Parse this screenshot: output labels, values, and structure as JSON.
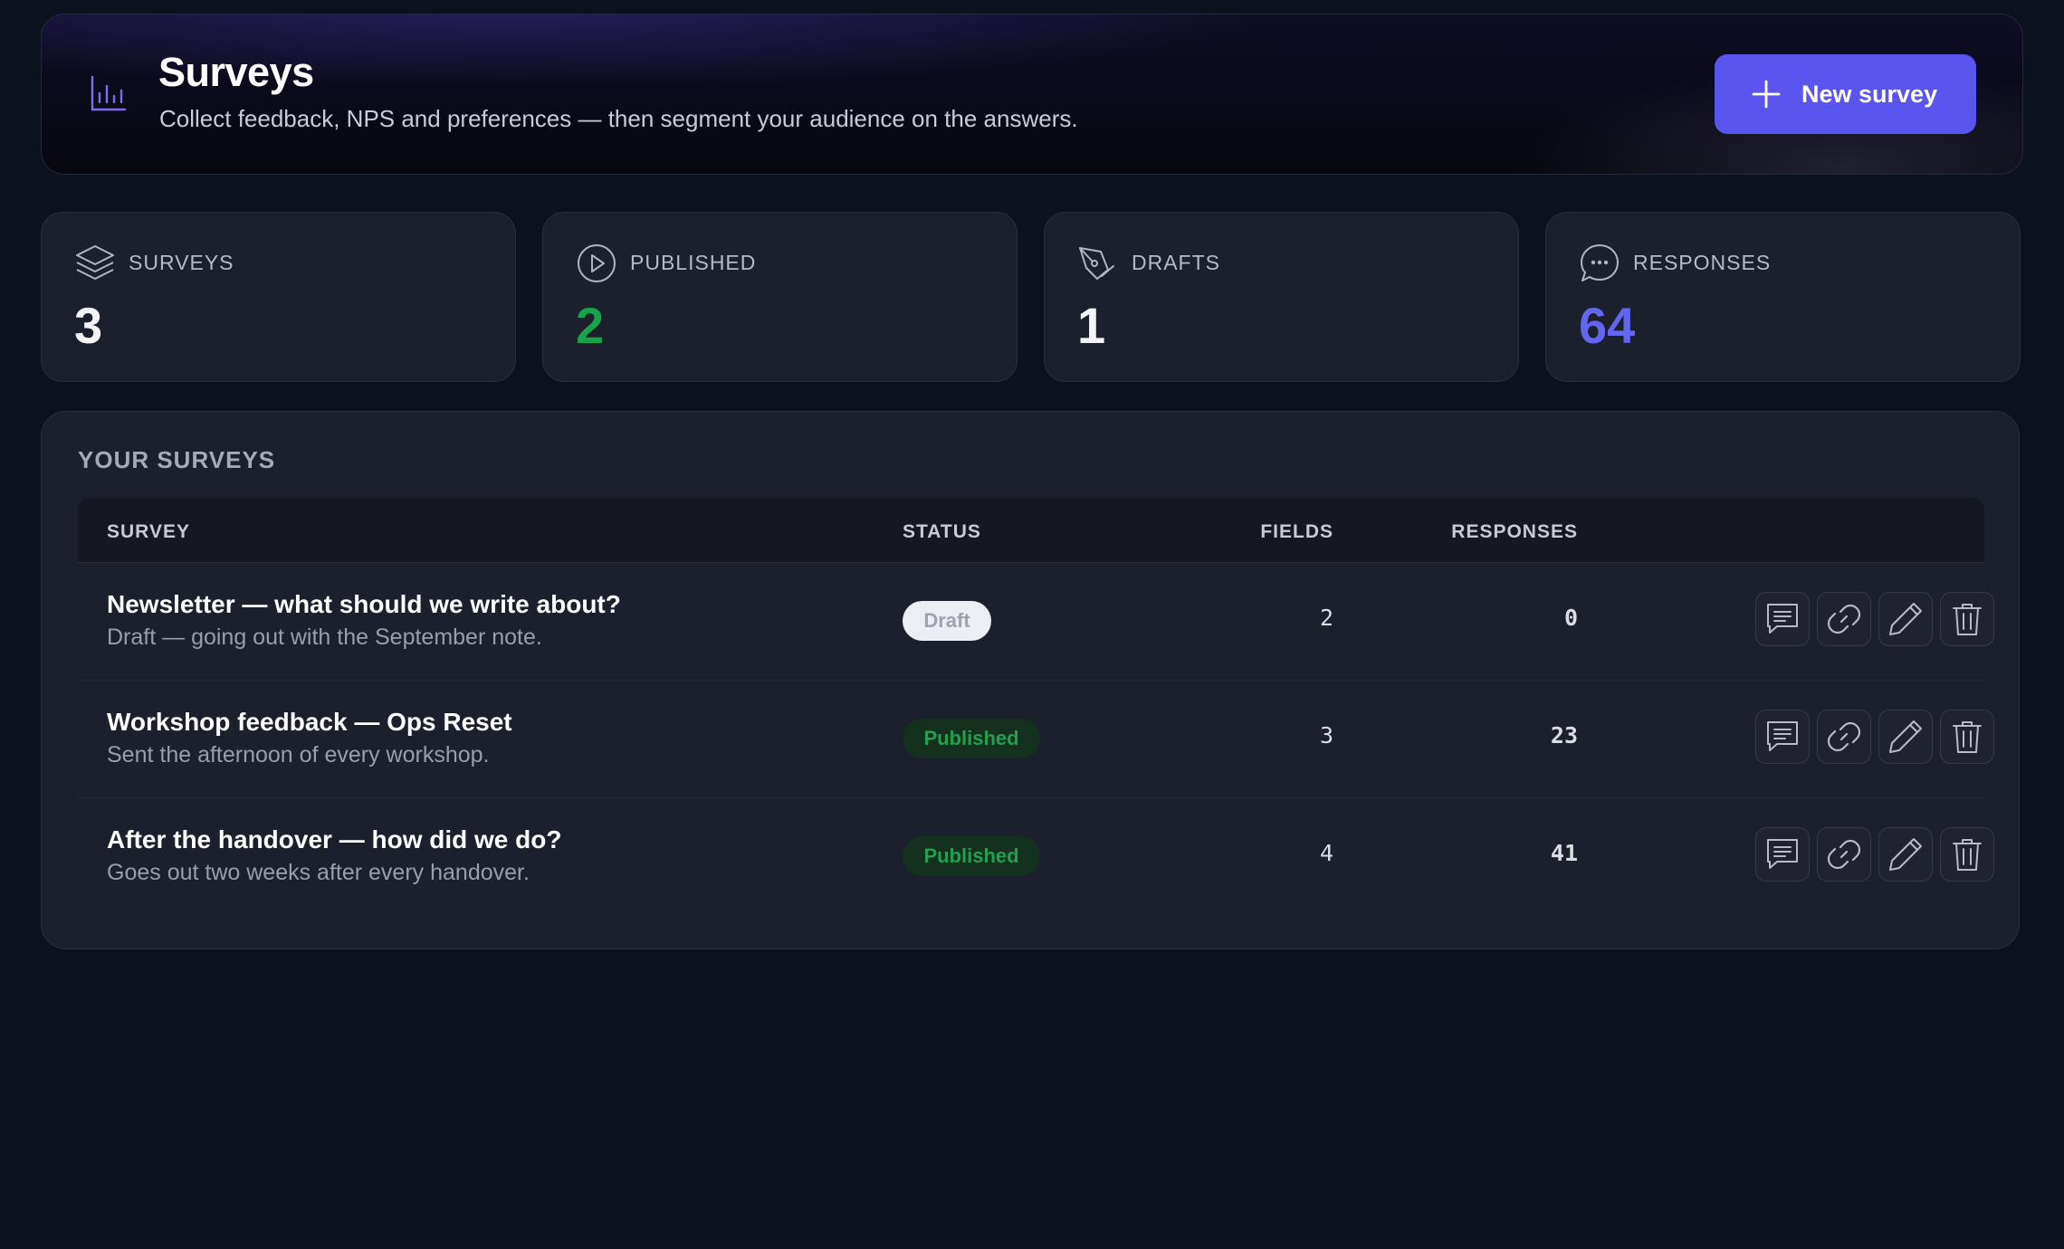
{
  "header": {
    "title": "Surveys",
    "subtitle": "Collect feedback, NPS and preferences — then segment your audience on the answers.",
    "icon": "bar-chart-icon",
    "new_button_label": "New survey"
  },
  "stats": [
    {
      "icon": "layers-icon",
      "label": "SURVEYS",
      "value": "3"
    },
    {
      "icon": "play-circle-icon",
      "label": "PUBLISHED",
      "value": "2",
      "color": "#16a34a"
    },
    {
      "icon": "pen-tool-icon",
      "label": "DRAFTS",
      "value": "1"
    },
    {
      "icon": "message-circle-icon",
      "label": "RESPONSES",
      "value": "64",
      "color": "#6366f1"
    }
  ],
  "table": {
    "title": "YOUR SURVEYS",
    "columns": {
      "survey": "SURVEY",
      "status": "STATUS",
      "fields": "FIELDS",
      "responses": "RESPONSES"
    },
    "rows": [
      {
        "title": "Newsletter — what should we write about?",
        "description": "Draft — going out with the September note.",
        "status": "Draft",
        "fields": "2",
        "responses": "0"
      },
      {
        "title": "Workshop feedback — Ops Reset",
        "description": "Sent the afternoon of every workshop.",
        "status": "Published",
        "fields": "3",
        "responses": "23"
      },
      {
        "title": "After the handover — how did we do?",
        "description": "Goes out two weeks after every handover.",
        "status": "Published",
        "fields": "4",
        "responses": "41"
      }
    ]
  },
  "colors": {
    "accent": "#5b55ef",
    "published": "#16a34a",
    "responses": "#6366f1",
    "background": "#0b111d"
  }
}
